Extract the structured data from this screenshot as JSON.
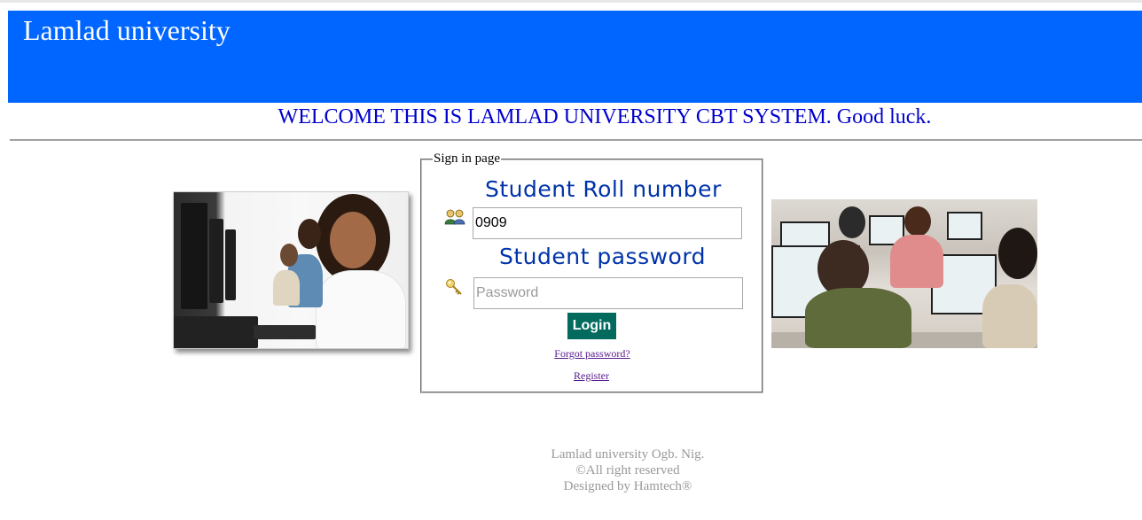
{
  "header": {
    "title": "Lamlad university"
  },
  "banner": {
    "welcome": "WELCOME THIS IS LAMLAD UNIVERSITY CBT SYSTEM. Good luck."
  },
  "signin": {
    "legend": "Sign in page",
    "roll_label": "Student Roll number",
    "roll_value": "0909",
    "password_label": "Student password",
    "password_placeholder": "Password",
    "login_label": "Login",
    "forgot_label": "Forgot password?",
    "register_label": "Register",
    "icons": {
      "roll": "users-icon",
      "password": "key-icon"
    }
  },
  "footer": {
    "line1": "Lamlad university Ogb. Nig.",
    "line2": "©All right reserved",
    "line3": "Designed by Hamtech®"
  },
  "colors": {
    "header_bg": "#0066ff",
    "welcome_text": "#0000cc",
    "label_text": "#0033aa",
    "login_bg": "#036b5e",
    "footer_text": "#999999"
  }
}
